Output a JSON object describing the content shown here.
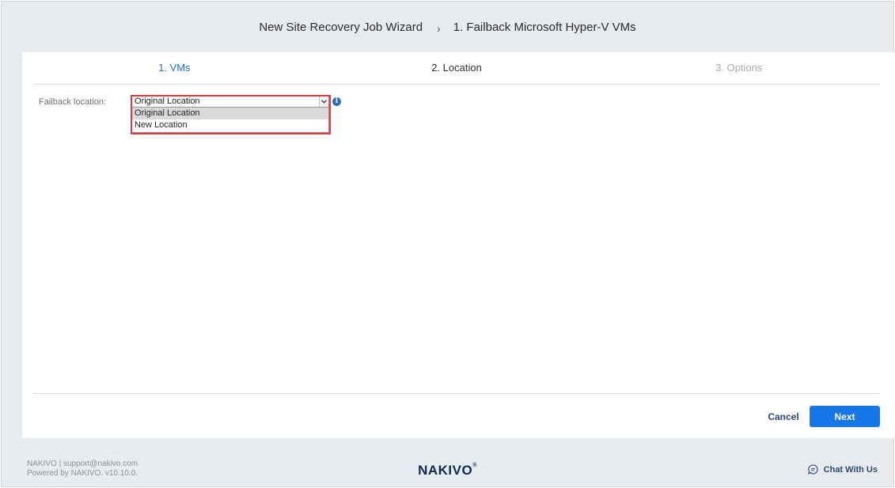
{
  "header": {
    "wizard_title": "New Site Recovery Job Wizard",
    "separator": "›",
    "subtitle": "1. Failback Microsoft Hyper-V VMs"
  },
  "steps": [
    {
      "label": "1. VMs",
      "state": "done"
    },
    {
      "label": "2. Location",
      "state": "active"
    },
    {
      "label": "3. Options",
      "state": "todo"
    }
  ],
  "form": {
    "failback_label": "Failback location:",
    "selected_value": "Original Location",
    "options": [
      "Original Location",
      "New Location"
    ],
    "info_icon": "i"
  },
  "buttons": {
    "cancel": "Cancel",
    "next": "Next"
  },
  "footer": {
    "line1": "NAKIVO | support@nakivo.com",
    "line2": "Powered by NAKIVO. v10.10.0.",
    "logo": "NAKIVO",
    "logo_mark": "®",
    "chat": "Chat With Us"
  },
  "colors": {
    "accent": "#1677e8",
    "highlight": "#e53a3a",
    "step_done": "#1f6fc4"
  }
}
